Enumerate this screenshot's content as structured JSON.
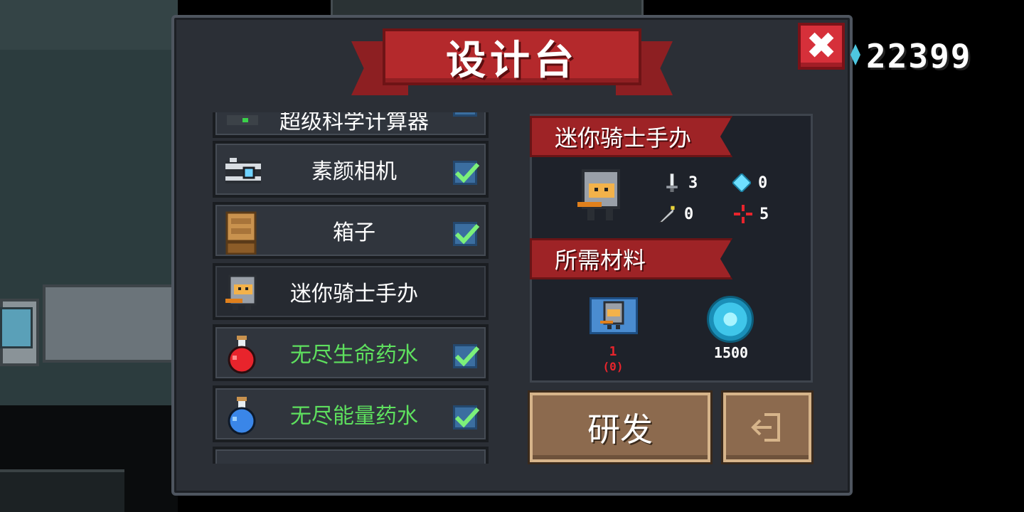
{
  "title": "设计台",
  "gem_counter": {
    "value": "22399",
    "icon": "gem-icon"
  },
  "close_button": {
    "label": "✖",
    "color": "#d6303a"
  },
  "list": {
    "items": [
      {
        "name": "item-calculator",
        "label": "超级科学计算器",
        "icon": "calculator-icon",
        "checked": true,
        "partial": true
      },
      {
        "name": "item-camera",
        "label": "素颜相机",
        "icon": "camera-icon",
        "checked": true
      },
      {
        "name": "item-box",
        "label": "箱子",
        "icon": "box-icon",
        "checked": true
      },
      {
        "name": "item-mini-knight",
        "label": "迷你骑士手办",
        "icon": "knight-figure-icon",
        "checked": false,
        "selected": true
      },
      {
        "name": "item-health-potion",
        "label": "无尽生命药水",
        "icon": "red-potion-icon",
        "checked": true,
        "color": "#5ee05e"
      },
      {
        "name": "item-energy-potion",
        "label": "无尽能量药水",
        "icon": "blue-potion-icon",
        "checked": true,
        "color": "#5ee05e"
      }
    ]
  },
  "detail": {
    "item_title": "迷你骑士手办",
    "stats": {
      "attack": "3",
      "energy": "0",
      "crit": "0",
      "precision": "5"
    },
    "materials_title": "所需材料",
    "materials": {
      "blueprint_count": "1",
      "blueprint_owned": "(0)",
      "gems": "1500"
    }
  },
  "buttons": {
    "research": "研发",
    "exit_icon": "exit-door-icon"
  },
  "colors": {
    "banner_red": "#b4292c",
    "panel_bg": "#2b2f36",
    "unlocked_green": "#5ee05e",
    "button_brown": "#8c6a4e"
  }
}
